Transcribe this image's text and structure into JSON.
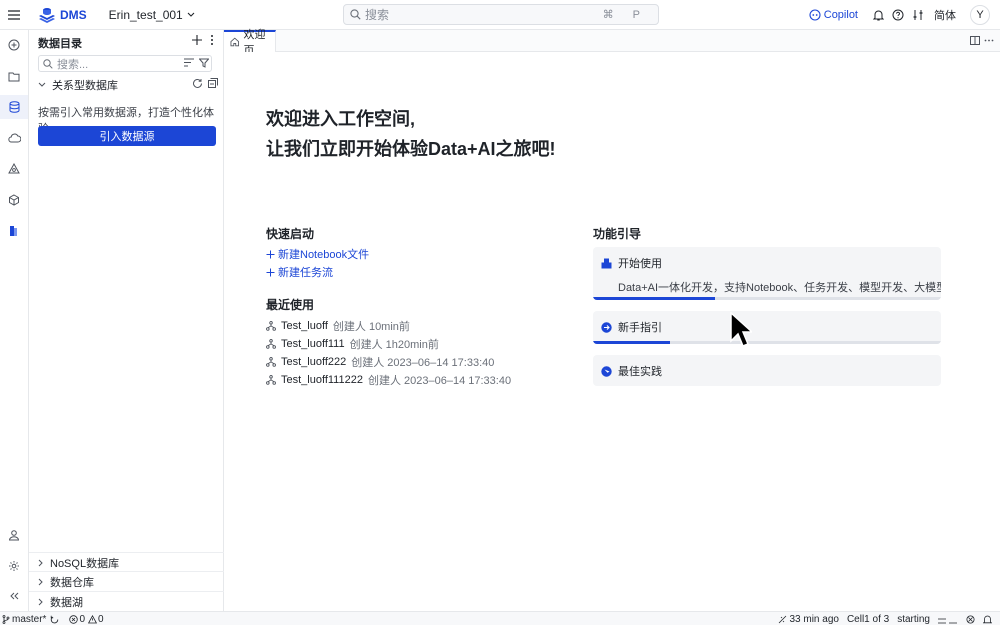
{
  "header": {
    "brand": "DMS",
    "workspace": "Erin_test_001",
    "search_placeholder": "搜索",
    "search_shortcut": "⌘ P",
    "copilot_label": "Copilot",
    "language": "简体",
    "avatar_initial": "Y"
  },
  "sidebar": {
    "title": "数据目录",
    "search_placeholder": "搜索...",
    "relational_label": "关系型数据库",
    "hint": "按需引入常用数据源，打造个性化体验。",
    "import_button": "引入数据源",
    "bottom_sections": [
      "NoSQL数据库",
      "数据仓库",
      "数据湖"
    ]
  },
  "tabs": [
    {
      "label": "欢迎页"
    }
  ],
  "welcome": {
    "line1": "欢迎进入工作空间,",
    "line2": "让我们立即开始体验Data+AI之旅吧!"
  },
  "quick_start": {
    "title": "快速启动",
    "items": [
      "新建Notebook文件",
      "新建任务流"
    ]
  },
  "recent": {
    "title": "最近使用",
    "items": [
      {
        "name": "Test_luoff",
        "meta": "创建人  10min前"
      },
      {
        "name": "Test_luoff111",
        "meta": "创建人  1h20min前"
      },
      {
        "name": "Test_luoff222",
        "meta": "创建人  2023–06–14 17:33:40"
      },
      {
        "name": "Test_luoff111222",
        "meta": "创建人  2023–06–14 17:33:40"
      }
    ]
  },
  "guide": {
    "title": "功能引导",
    "cards": [
      {
        "title": "开始使用",
        "desc": "Data+AI一体化开发，支持Notebook、任务开发、模型开发、大模型应用开发",
        "progress": 0.35
      },
      {
        "title": "新手指引",
        "progress": 0.22
      },
      {
        "title": "最佳实践"
      }
    ]
  },
  "statusbar": {
    "branch": "master*",
    "errors": "0",
    "warnings": "0",
    "commit_time": "33 min ago",
    "cell": "Cell1 of 3",
    "kernel_state": "starting"
  },
  "colors": {
    "accent": "#1c46d6",
    "card_bg": "#f4f5f7",
    "border": "#e6e8eb"
  }
}
